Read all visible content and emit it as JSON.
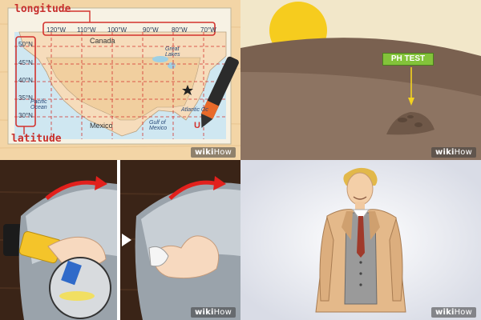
{
  "panel1": {
    "longitude_label": "longitude",
    "latitude_label": "latitude",
    "lon_ticks": [
      "120°W",
      "110°W",
      "100°W",
      "90°W",
      "80°W",
      "70°W"
    ],
    "lat_ticks": [
      "50°N",
      "45°N",
      "40°N",
      "35°N",
      "30°N"
    ],
    "canada": "Canada",
    "mexico": "Mexico",
    "pacific": "Pacific\nOcean",
    "atlantic": "Atlantic Oc",
    "gulf": "Gulf of\nMexico",
    "great_lakes": "Great\nLakes",
    "map_corner": "U"
  },
  "panel2": {
    "label": "PH TEST"
  },
  "watermark": {
    "brand": "wiki",
    "suffix": "How"
  }
}
